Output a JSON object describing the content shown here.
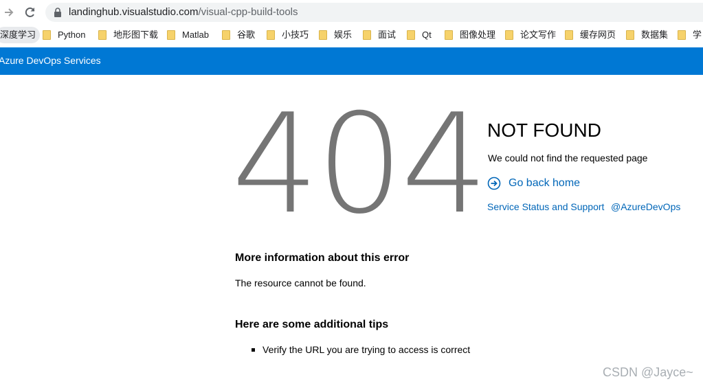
{
  "browser": {
    "url_host": "landinghub.visualstudio.com",
    "url_path": "/visual-cpp-build-tools",
    "icons": {
      "forward": "arrow-right-icon",
      "reload": "reload-icon",
      "lock": "lock-icon"
    }
  },
  "bookmarks": {
    "first": "深度学习",
    "items": [
      "Python",
      "地形图下载",
      "Matlab",
      "谷歌",
      "小技巧",
      "娱乐",
      "面试",
      "Qt",
      "图像处理",
      "论文写作",
      "缓存网页",
      "数据集",
      "学"
    ]
  },
  "azure": {
    "brand_color": "#0078d4",
    "title": "Azure DevOps Services"
  },
  "error": {
    "code": "404",
    "title": "NOT FOUND",
    "description": "We could not find the requested page",
    "home_link": "Go back home",
    "support_link": "Service Status and Support",
    "twitter_link": "@AzureDevOps",
    "more_heading": "More information about this error",
    "more_text": "The resource cannot be found.",
    "tips_heading": "Here are some additional tips",
    "tips": [
      "Verify the URL you are trying to access is correct"
    ]
  },
  "watermark": "CSDN @Jayce~"
}
